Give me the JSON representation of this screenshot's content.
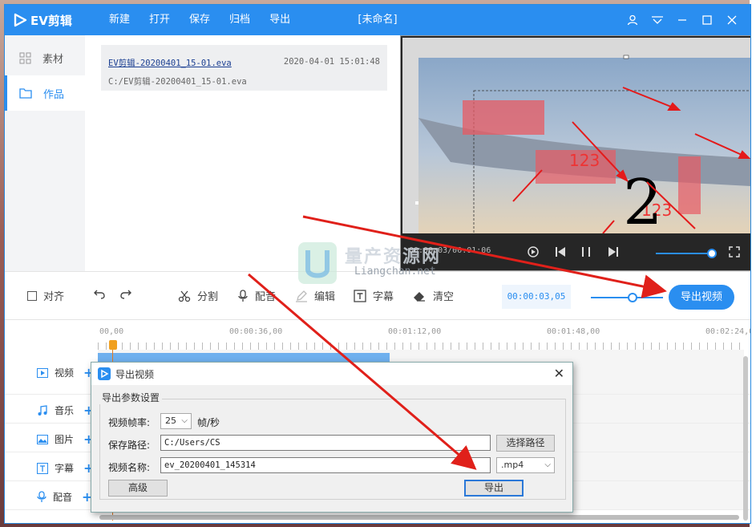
{
  "app": {
    "logo_text": "EV剪辑",
    "doc_title": "[未命名]"
  },
  "menu": [
    "新建",
    "打开",
    "保存",
    "归档",
    "导出"
  ],
  "leftnav": [
    {
      "label": "素材",
      "icon": "grid-icon"
    },
    {
      "label": "作品",
      "icon": "folder-icon"
    }
  ],
  "file": {
    "name": "EV剪辑-20200401_15-01.eva",
    "date": "2020-04-01 15:01:48",
    "path": "C:/EV剪辑-20200401_15-01.eva"
  },
  "preview": {
    "time": "00:00:03/00:01:06",
    "overlay_number": "2",
    "overlay_text1": "123",
    "overlay_text2": "123"
  },
  "toolbar": {
    "align_label": "对齐",
    "split_label": "分割",
    "dub_label": "配音",
    "edit_label": "编辑",
    "subtitle_label": "字幕",
    "clear_label": "清空",
    "timecode": "00:00:03,05",
    "export_label": "导出视频"
  },
  "ruler": [
    "00,00",
    "00:00:36,00",
    "00:01:12,00",
    "00:01:48,00",
    "00:02:24,0"
  ],
  "tracks": [
    {
      "label": "视频",
      "icon": "video-icon"
    },
    {
      "label": "音乐",
      "icon": "music-icon"
    },
    {
      "label": "图片",
      "icon": "image-icon"
    },
    {
      "label": "字幕",
      "icon": "text-icon"
    },
    {
      "label": "配音",
      "icon": "mic-icon"
    }
  ],
  "dialog": {
    "title": "导出视频",
    "group_label": "导出参数设置",
    "fps_label": "视频帧率:",
    "fps_value": "25",
    "fps_unit": "帧/秒",
    "path_label": "保存路径:",
    "path_value": "C:/Users/CS",
    "choose_path": "选择路径",
    "name_label": "视频名称:",
    "name_value": "ev_20200401_145314",
    "format_value": ".mp4",
    "advanced_label": "高级",
    "export_label": "导出"
  },
  "watermark": {
    "title": "量产资源网",
    "url": "Liangchan.net"
  },
  "colors": {
    "accent": "#2a8ef0",
    "arrow": "#e0201a"
  }
}
